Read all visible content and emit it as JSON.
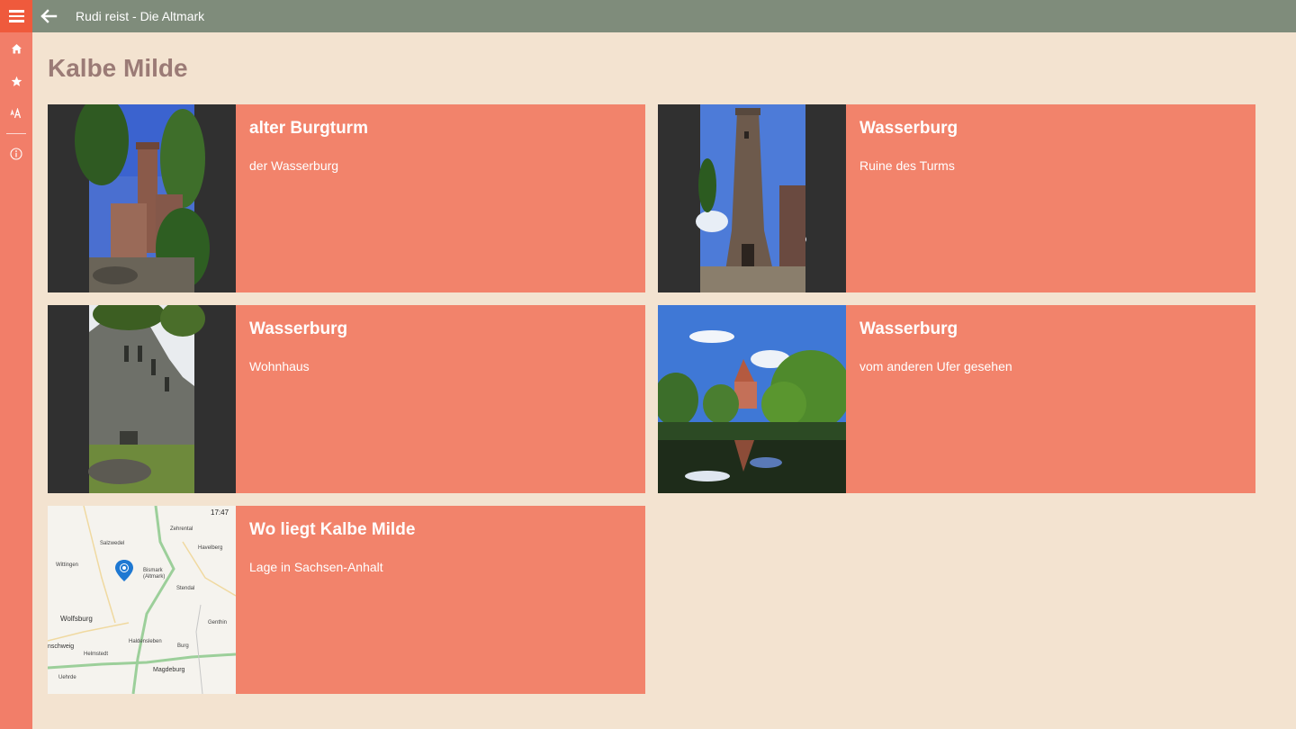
{
  "app": {
    "title": "Rudi reist - Die Altmark"
  },
  "page": {
    "title": "Kalbe Milde"
  },
  "tiles": [
    {
      "title": "alter Burgturm",
      "subtitle": "der Wasserburg"
    },
    {
      "title": "Wasserburg",
      "subtitle": "Ruine des Turms"
    },
    {
      "title": "Wasserburg",
      "subtitle": "Wohnhaus"
    },
    {
      "title": "Wasserburg",
      "subtitle": "vom anderen Ufer gesehen"
    },
    {
      "title": "Wo liegt Kalbe Milde",
      "subtitle": "Lage in Sachsen-Anhalt"
    }
  ],
  "map": {
    "time": "17:47",
    "labels": {
      "salzwedel": "Salzwedel",
      "zehrental": "Zehrental",
      "havelberg": "Havelberg",
      "wittingen": "Wittingen",
      "bismark": "Bismark",
      "altmark": "(Altmark)",
      "stendal": "Stendal",
      "wolfsburg": "Wolfsburg",
      "genthin": "Genthin",
      "schweig": "nschweig",
      "helmstedt": "Helmstedt",
      "haldensleben": "Haldensleben",
      "burg": "Burg",
      "magdeburg": "Magdeburg",
      "uehrde": "Uehrde"
    }
  },
  "icons": {
    "menu": "hamburger-menu-icon",
    "back": "back-arrow-icon",
    "home": "home-icon",
    "favorites": "star-icon",
    "font": "font-size-icon",
    "info": "info-icon"
  },
  "colors": {
    "rail": "#f27e69",
    "menu_button": "#ef5a3c",
    "topbar": "#7f8c7b",
    "background": "#f3e3d0",
    "tile": "#f2836b",
    "page_title": "#9b7b76"
  }
}
